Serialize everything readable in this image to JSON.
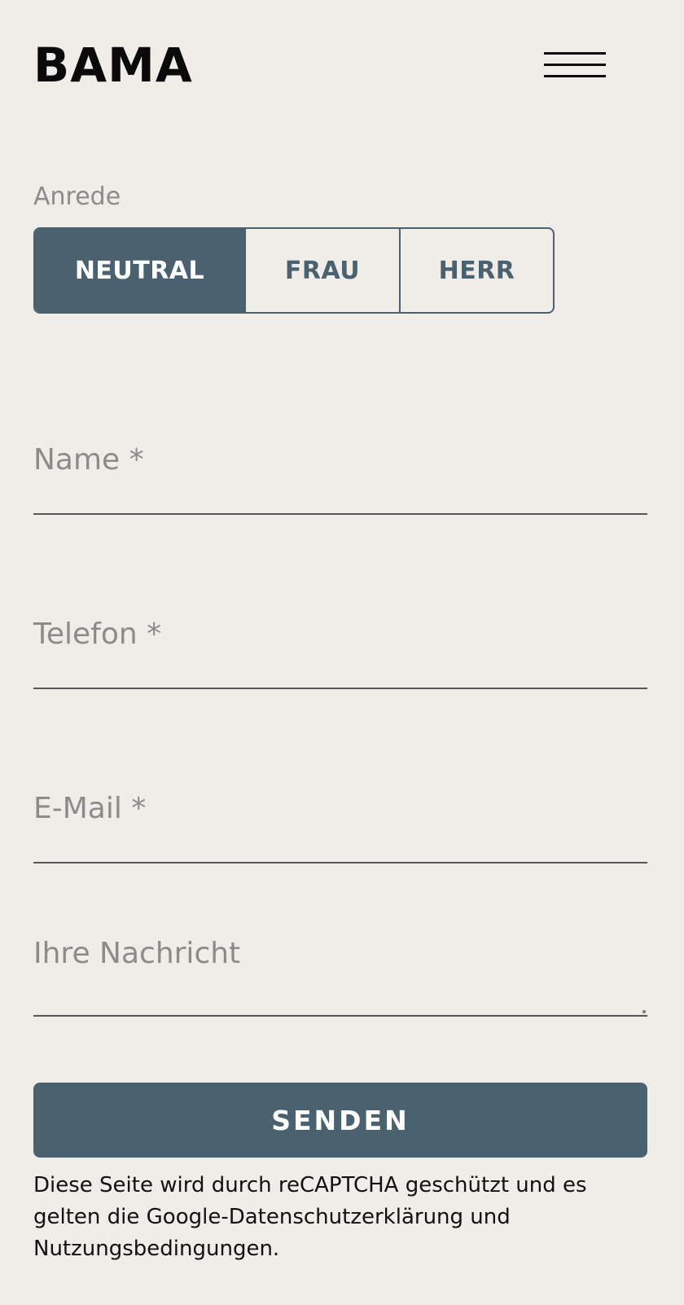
{
  "header": {
    "logo_text": "BAMA",
    "menu_icon": "hamburger-menu-icon"
  },
  "form": {
    "salutation": {
      "label": "Anrede",
      "options": [
        "NEUTRAL",
        "FRAU",
        "HERR"
      ],
      "selected": "NEUTRAL"
    },
    "fields": {
      "name": {
        "placeholder": "Name *",
        "value": ""
      },
      "phone": {
        "placeholder": "Telefon *",
        "value": ""
      },
      "email": {
        "placeholder": "E-Mail *",
        "value": ""
      },
      "message": {
        "placeholder": "Ihre Nachricht",
        "value": ""
      }
    },
    "submit_label": "SENDEN",
    "recaptcha_notice": "Diese Seite wird durch reCAPTCHA geschützt und es gelten die Google-Datenschutzerklärung und Nutzungsbedingungen."
  },
  "colors": {
    "background": "#f0ede9",
    "accent": "#4a6270",
    "placeholder": "#8d8b88",
    "text": "#111111"
  }
}
